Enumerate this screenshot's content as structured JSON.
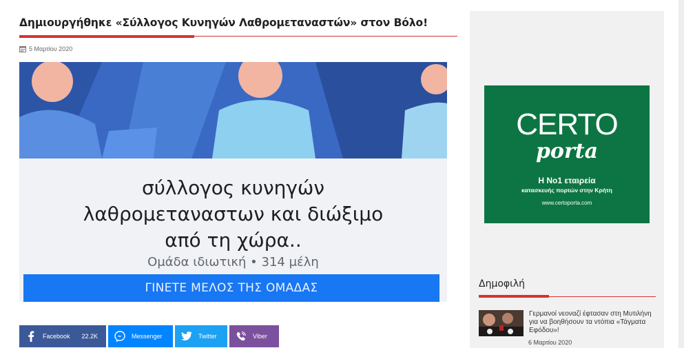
{
  "article": {
    "title": "Δημιουργήθηκε «Σύλλογος Κυνηγών Λαθρομεταναστών» στον Βόλο!",
    "date": "5 Μαρτίου 2020"
  },
  "hero_image": {
    "line1": "σύλλογος κυνηγών",
    "line2": "λαθρομεταναστων και διώξιμο",
    "line3": "από τη χώρα..",
    "meta": "Ομάδα ιδιωτική  •  314 μέλη",
    "join_button": "ΓΙΝΕΤΕ ΜΕΛΟΣ ΤΗΣ ΟΜΑΔΑΣ"
  },
  "share": {
    "facebook_label": "Facebook",
    "facebook_count": "22.2K",
    "messenger_label": "Messenger",
    "twitter_label": "Twitter",
    "viber_label": "Viber"
  },
  "sidebar": {
    "ad": {
      "brand_top": "CERTO",
      "brand_bottom": "porta",
      "tagline": "Η Νο1 εταιρεία",
      "subtagline": "κατασκευής πορτών στην Κρήτη",
      "url": "www.certoporta.com"
    },
    "popular_title": "Δημοφιλή",
    "popular_items": [
      {
        "title": "Γερμανοί νεοναζί έφτασαν στη Μυτιλήνη για να βοηθήσουν τα ντόπια «Τάγματα Εφόδου»!",
        "date": "6 Μαρτίου 2020"
      }
    ]
  },
  "colors": {
    "accent_red": "#d63333",
    "facebook": "#3b5998",
    "messenger": "#0084ff",
    "twitter": "#1da1f2",
    "viber": "#7b519d",
    "ad_green": "#0d7543"
  }
}
